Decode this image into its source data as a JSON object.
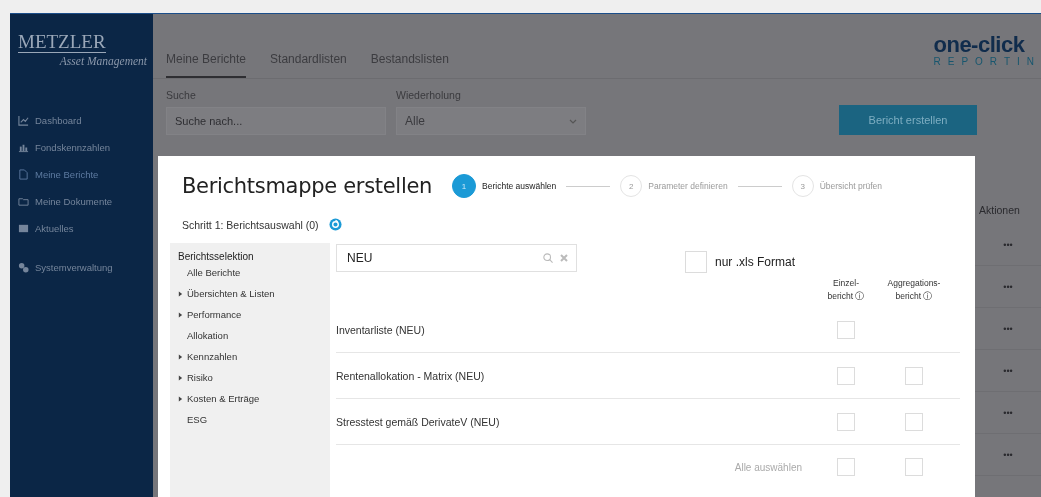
{
  "brand": {
    "name": "METZLER",
    "subtitle": "Asset Management"
  },
  "sidebar": {
    "items": [
      {
        "label": "Dashboard",
        "selected": false
      },
      {
        "label": "Fondskennzahlen",
        "selected": false
      },
      {
        "label": "Meine Berichte",
        "selected": true
      },
      {
        "label": "Meine Dokumente",
        "selected": false
      },
      {
        "label": "Aktuelles",
        "selected": false
      }
    ],
    "admin_items": [
      {
        "label": "Systemverwaltung",
        "selected": false
      }
    ]
  },
  "logo": {
    "name": "one-click",
    "tagline": "REPORTIN"
  },
  "tabs": [
    {
      "label": "Meine Berichte",
      "selected": true
    },
    {
      "label": "Standardlisten",
      "selected": false
    },
    {
      "label": "Bestandslisten",
      "selected": false
    }
  ],
  "filters": {
    "search": {
      "label": "Suche",
      "placeholder": "Suche nach..."
    },
    "repeat": {
      "label": "Wiederholung",
      "value": "Alle"
    },
    "create_button": "Bericht erstellen"
  },
  "table": {
    "actions_header": "Aktionen",
    "action_rows": [
      "•••",
      "•••",
      "•••",
      "•••",
      "•••",
      "•••"
    ]
  },
  "dialog": {
    "title": "Berichtsmappe erstellen",
    "steps": [
      {
        "number": "1",
        "label": "Berichte auswählen",
        "selected": true
      },
      {
        "number": "2",
        "label": "Parameter definieren",
        "selected": false
      },
      {
        "number": "3",
        "label": "Übersicht prüfen",
        "selected": false
      }
    ],
    "step_heading": "Schritt 1: Berichtsauswahl (0)",
    "selection": {
      "heading": "Berichtsselektion",
      "items": [
        {
          "label": "Alle Berichte",
          "kind": "leaf"
        },
        {
          "label": "Übersichten & Listen",
          "kind": "group",
          "expanded": false
        },
        {
          "label": "Performance",
          "kind": "group",
          "expanded": false
        },
        {
          "label": "Allokation",
          "kind": "leaf"
        },
        {
          "label": "Kennzahlen",
          "kind": "group",
          "expanded": false
        },
        {
          "label": "Risiko",
          "kind": "group",
          "expanded": false
        },
        {
          "label": "Kosten & Erträge",
          "kind": "group",
          "expanded": false
        },
        {
          "label": "ESG",
          "kind": "leaf"
        }
      ]
    },
    "search": {
      "value": "NEU"
    },
    "xls_only": {
      "label": "nur .xls Format",
      "checked": false
    },
    "columns": [
      {
        "line1": "Einzel-",
        "line2": "bericht ⓘ"
      },
      {
        "line1": "Aggregations-",
        "line2": "bericht ⓘ"
      }
    ],
    "reports": [
      {
        "name": "Inventarliste (NEU)",
        "single": {
          "checked": false
        }
      },
      {
        "name": "Rentenallokation - Matrix (NEU)",
        "single": {
          "checked": false
        },
        "aggregation": {
          "checked": false
        }
      },
      {
        "name": "Stresstest gemäß DerivateV (NEU)",
        "single": {
          "checked": false
        },
        "aggregation": {
          "checked": false
        }
      }
    ],
    "select_all": {
      "label": "Alle auswählen",
      "single": {
        "checked": false
      },
      "aggregation": {
        "checked": false
      }
    }
  }
}
